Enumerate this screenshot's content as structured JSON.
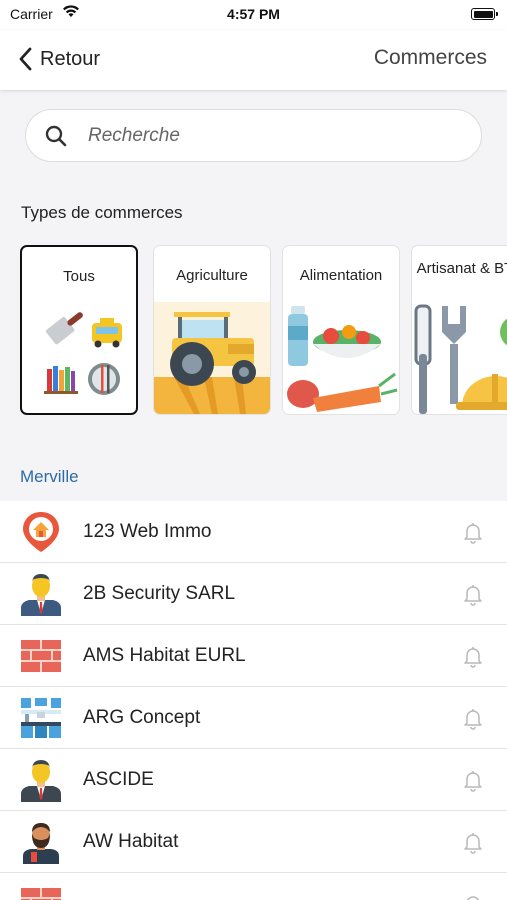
{
  "status_bar": {
    "carrier": "Carrier",
    "time": "4:57 PM"
  },
  "nav": {
    "back_label": "Retour",
    "title": "Commerces"
  },
  "search": {
    "placeholder": "Recherche",
    "value": ""
  },
  "categories_label": "Types de commerces",
  "categories": [
    {
      "label": "Tous",
      "selected": true,
      "icon": "all-types-icon"
    },
    {
      "label": "Agriculture",
      "selected": false,
      "icon": "tractor-icon"
    },
    {
      "label": "Alimentation",
      "selected": false,
      "icon": "vegetables-icon"
    },
    {
      "label": "Artisanat & BTP",
      "selected": false,
      "icon": "tools-helmet-icon"
    }
  ],
  "city": "Merville",
  "shops": [
    {
      "name": "123 Web Immo",
      "icon": "home-pin-icon"
    },
    {
      "name": "2B Security SARL",
      "icon": "businessman-icon"
    },
    {
      "name": "AMS Habitat EURL",
      "icon": "brick-wall-icon"
    },
    {
      "name": "ARG Concept",
      "icon": "kitchen-icon"
    },
    {
      "name": "ASCIDE",
      "icon": "businessman-icon"
    },
    {
      "name": "AW Habitat",
      "icon": "bearded-man-icon"
    },
    {
      "name": "",
      "icon": "brick-wall-icon"
    }
  ],
  "colors": {
    "accent_city": "#2d6aa8",
    "selected_border": "#111111"
  }
}
